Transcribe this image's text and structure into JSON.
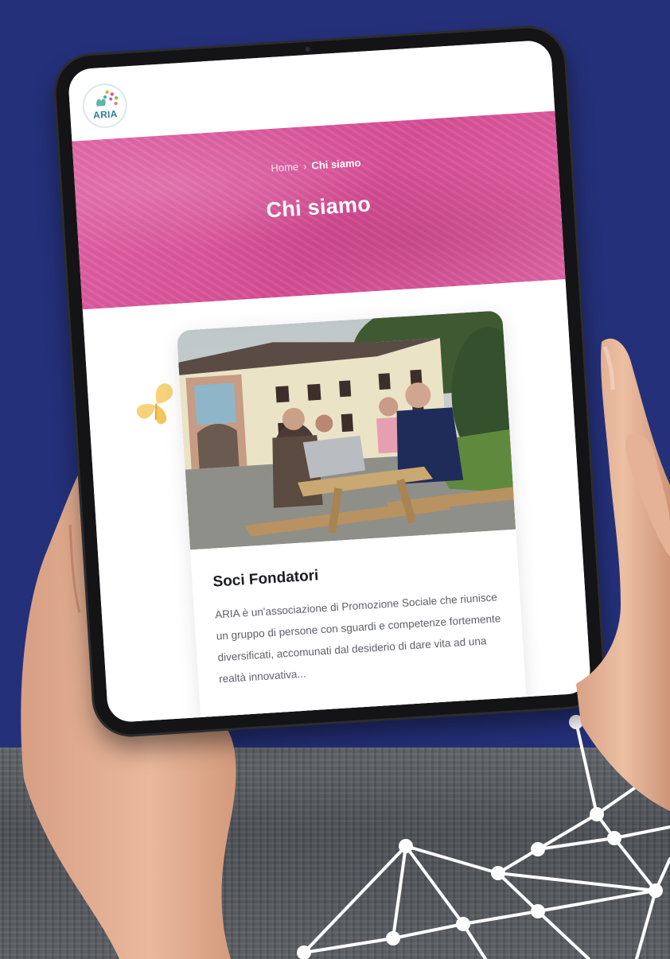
{
  "site": {
    "logo_text": "ARIA"
  },
  "breadcrumb": {
    "home": "Home",
    "separator": "›",
    "current": "Chi siamo"
  },
  "hero": {
    "title": "Chi siamo"
  },
  "card": {
    "title": "Soci Fondatori",
    "text": "ARIA è un'associazione di Promozione Sociale che riunisce un gruppo di persone con sguardi e competenze fortemente diversificati, accomunati dal desiderio di dare vita ad una realtà innovativa..."
  },
  "colors": {
    "background": "#243079",
    "hero_pink": "#d94f97",
    "network_lines": "#ffffff",
    "butterfly": "#f6d27a"
  }
}
